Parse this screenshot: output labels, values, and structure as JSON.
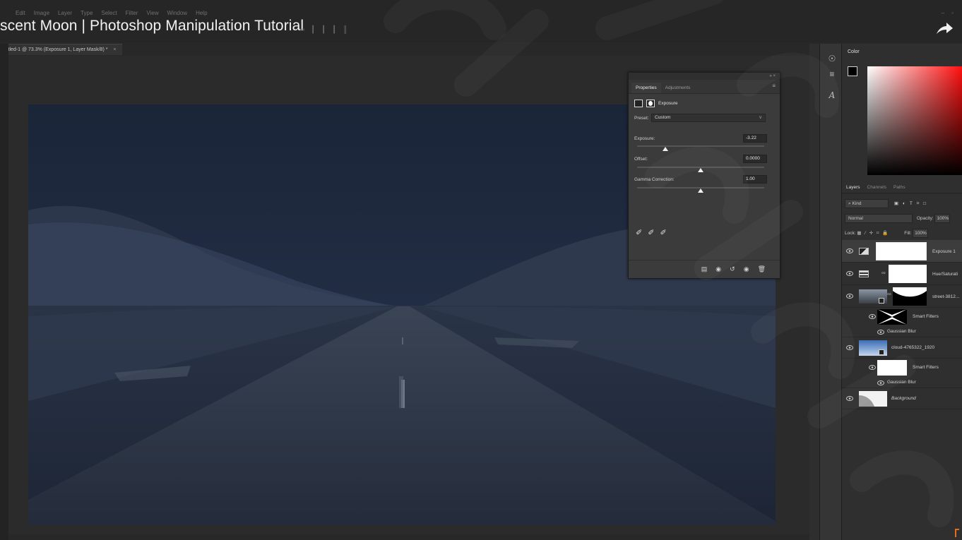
{
  "menu": [
    "Edit",
    "Image",
    "Layer",
    "Type",
    "Select",
    "Filter",
    "View",
    "Window",
    "Help"
  ],
  "video_title": "scent Moon | Photoshop Manipulation Tutorial",
  "window_controls": "– ▫",
  "doc_tab": {
    "label": "titled-1 @ 73.3% (Exposure 1, Layer Mask/8) *",
    "close": "×"
  },
  "properties": {
    "tabs": [
      "Properties",
      "Adjustments"
    ],
    "active_tab": "Properties",
    "header": "Exposure",
    "preset_label": "Preset:",
    "preset_value": "Custom",
    "exposure_label": "Exposure:",
    "exposure_value": "-3.22",
    "exposure_slider_fraction": 0.22,
    "offset_label": "Offset:",
    "offset_value": "0.0000",
    "offset_slider_fraction": 0.5,
    "gamma_label": "Gamma Correction:",
    "gamma_value": "1.00",
    "gamma_slider_fraction": 0.5,
    "eyedroppers": [
      "black-point-eyedropper-icon",
      "gray-point-eyedropper-icon",
      "white-point-eyedropper-icon"
    ],
    "footer_icons": [
      "clip-to-layer-icon",
      "view-previous-state-icon",
      "reset-icon",
      "visibility-icon",
      "trash-icon"
    ]
  },
  "color_panel": {
    "title": "Color"
  },
  "layers_panel": {
    "tabs": [
      "Layers",
      "Channels",
      "Paths"
    ],
    "active_tab": "Layers",
    "filter_label": "Kind",
    "blend_mode": "Normal",
    "opacity_label": "Opacity:",
    "opacity_value": "100%",
    "lock_label": "Lock:",
    "fill_label": "Fill:",
    "fill_value": "100%",
    "layers": [
      {
        "name": "Exposure 1",
        "kind": "adjustment",
        "selected": true
      },
      {
        "name": "Hue/Saturati",
        "kind": "adjustment",
        "selected": false
      },
      {
        "name": "street-3812...",
        "kind": "smart-object",
        "selected": false
      },
      {
        "name": "Smart Filters",
        "kind": "smart-filters",
        "selected": false
      },
      {
        "name": "Gaussian Blur",
        "kind": "filter",
        "selected": false
      },
      {
        "name": "cloud-4765322_1920",
        "kind": "smart-object",
        "selected": false
      },
      {
        "name": "Smart Filters",
        "kind": "smart-filters",
        "selected": false
      },
      {
        "name": "Gaussian Blur",
        "kind": "filter",
        "selected": false
      },
      {
        "name": "Background",
        "kind": "background",
        "selected": false
      }
    ]
  },
  "colors": {
    "canvas_tint": "#1e2a3f",
    "panel_bg": "#2f2f2f",
    "accent": "#e0701e"
  }
}
